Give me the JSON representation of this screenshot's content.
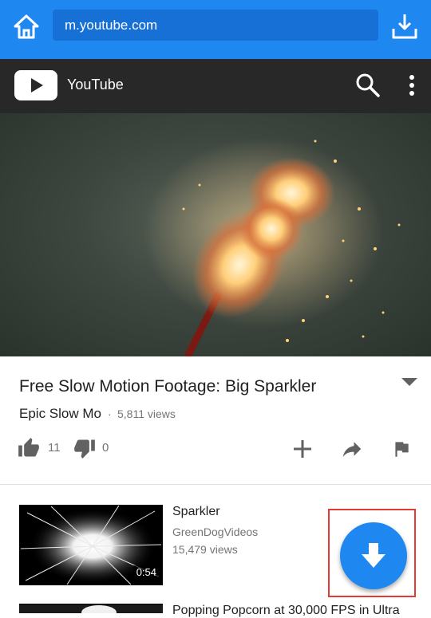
{
  "browser": {
    "url": "m.youtube.com",
    "accent_color": "#1e88f0",
    "icons": [
      "home-icon",
      "download-icon"
    ]
  },
  "header": {
    "title": "YouTube",
    "icons": [
      "youtube-logo-icon",
      "search-icon",
      "more-vert-icon"
    ]
  },
  "video": {
    "title": "Free Slow Motion Footage: Big Sparkler",
    "channel": "Epic Slow Mo",
    "separator": "·",
    "views": "5,811 views",
    "likes": "11",
    "dislikes": "0"
  },
  "related": [
    {
      "title": "Sparkler",
      "channel": "GreenDogVideos",
      "views": "15,479 views",
      "duration": "0:54"
    },
    {
      "title": "Popping Popcorn at 30,000 FPS in Ultra"
    }
  ],
  "fab": {
    "icon": "download-arrow-icon",
    "color": "#1e88f0",
    "highlight_color": "#e53935"
  }
}
